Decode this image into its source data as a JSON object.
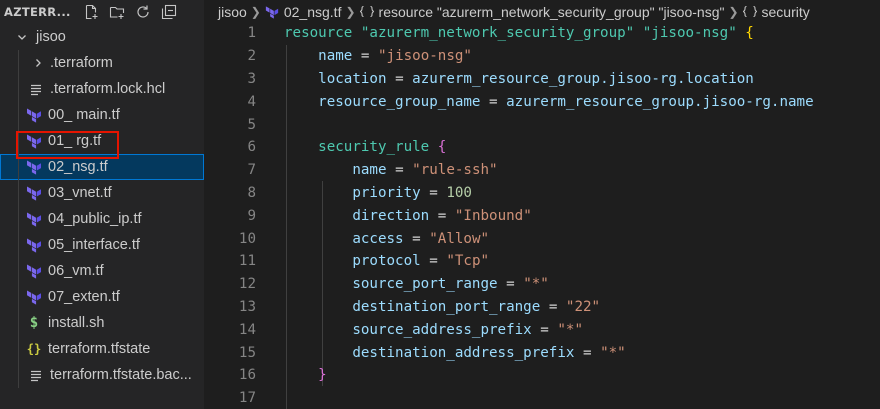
{
  "sidebar": {
    "title": "AZTERR...",
    "actions": [
      {
        "name": "new-file-icon"
      },
      {
        "name": "new-folder-icon"
      },
      {
        "name": "refresh-icon"
      },
      {
        "name": "collapse-all-icon"
      }
    ],
    "folder": {
      "label": "jisoo"
    },
    "items": [
      {
        "label": ".terraform",
        "icon": "chevron-right-icon",
        "kind": "folder"
      },
      {
        "label": ".terraform.lock.hcl",
        "icon": "lines-icon",
        "kind": "file"
      },
      {
        "label": "00_ main.tf",
        "icon": "terraform-icon",
        "kind": "file"
      },
      {
        "label": "01_ rg.tf",
        "icon": "terraform-icon",
        "kind": "file"
      },
      {
        "label": "02_nsg.tf",
        "icon": "terraform-icon",
        "kind": "file",
        "selected": true
      },
      {
        "label": "03_vnet.tf",
        "icon": "terraform-icon",
        "kind": "file"
      },
      {
        "label": "04_public_ip.tf",
        "icon": "terraform-icon",
        "kind": "file"
      },
      {
        "label": "05_interface.tf",
        "icon": "terraform-icon",
        "kind": "file"
      },
      {
        "label": "06_vm.tf",
        "icon": "terraform-icon",
        "kind": "file"
      },
      {
        "label": "07_exten.tf",
        "icon": "terraform-icon",
        "kind": "file"
      },
      {
        "label": "install.sh",
        "icon": "dollar-icon",
        "kind": "file"
      },
      {
        "label": "terraform.tfstate",
        "icon": "braces-icon",
        "kind": "file"
      },
      {
        "label": "terraform.tfstate.bac...",
        "icon": "lines-icon",
        "kind": "file"
      }
    ]
  },
  "breadcrumb": {
    "folder": "jisoo",
    "file": "02_nsg.tf",
    "symbol": "resource \"azurerm_network_security_group\" \"jisoo-nsg\"",
    "child": "security"
  },
  "editor": {
    "lines": [
      {
        "n": "1"
      },
      {
        "n": "2"
      },
      {
        "n": "3"
      },
      {
        "n": "4"
      },
      {
        "n": "5"
      },
      {
        "n": "6"
      },
      {
        "n": "7"
      },
      {
        "n": "8"
      },
      {
        "n": "9"
      },
      {
        "n": "10"
      },
      {
        "n": "11"
      },
      {
        "n": "12"
      },
      {
        "n": "13"
      },
      {
        "n": "14"
      },
      {
        "n": "15"
      },
      {
        "n": "16"
      },
      {
        "n": "17"
      }
    ],
    "code": {
      "l1_kw": "resource",
      "l1_type": "\"azurerm_network_security_group\"",
      "l1_name": "\"jisoo-nsg\"",
      "l1_brace": "{",
      "l2_key": "name",
      "l2_val": "\"jisoo-nsg\"",
      "l3_key": "location",
      "l3_val": "azurerm_resource_group.jisoo-rg.location",
      "l4_key": "resource_group_name",
      "l4_val": "azurerm_resource_group.jisoo-rg.name",
      "l6_block": "security_rule",
      "l6_brace": "{",
      "l7_key": "name",
      "l7_val": "\"rule-ssh\"",
      "l8_key": "priority",
      "l8_val": "100",
      "l9_key": "direction",
      "l9_val": "\"Inbound\"",
      "l10_key": "access",
      "l10_val": "\"Allow\"",
      "l11_key": "protocol",
      "l11_val": "\"Tcp\"",
      "l12_key": "source_port_range",
      "l12_val": "\"*\"",
      "l13_key": "destination_port_range",
      "l13_val": "\"22\"",
      "l14_key": "source_address_prefix",
      "l14_val": "\"*\"",
      "l15_key": "destination_address_prefix",
      "l15_val": "\"*\"",
      "l16_brace": "}",
      "eq": "="
    }
  }
}
